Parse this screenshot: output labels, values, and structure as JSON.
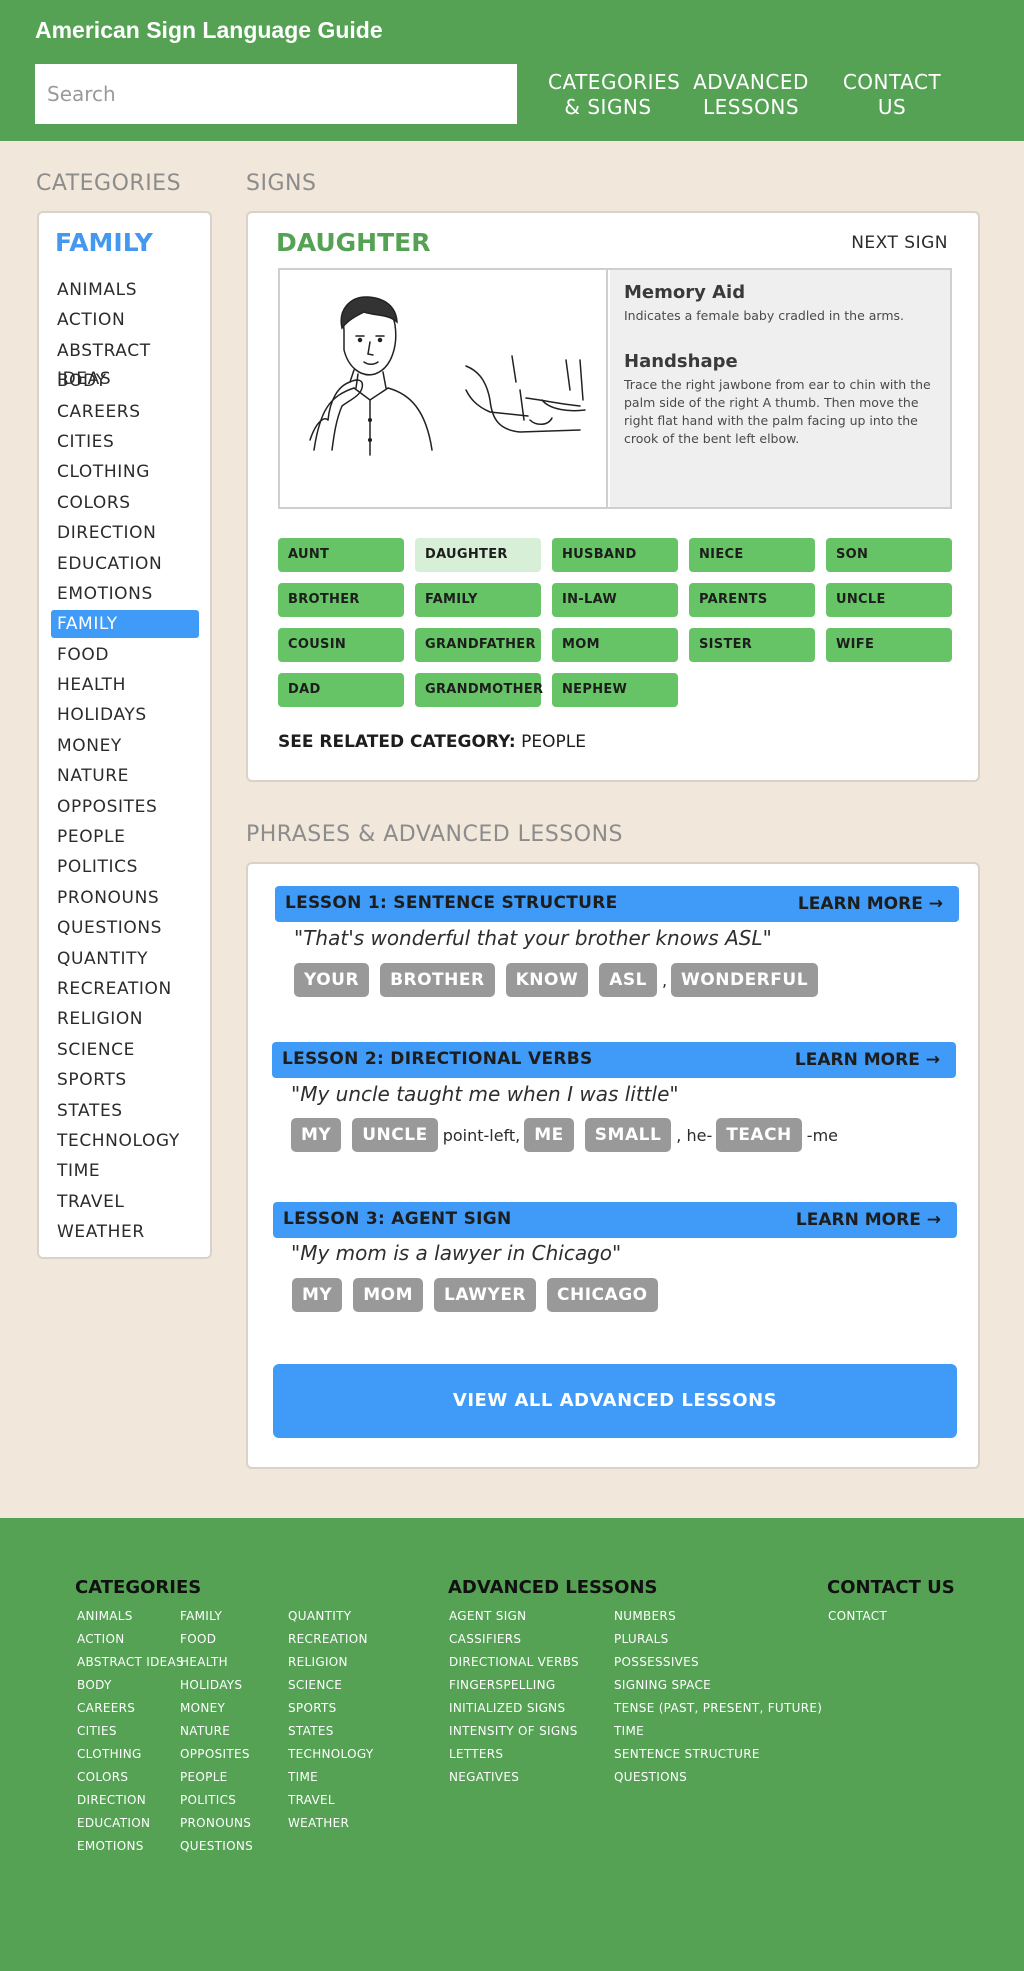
{
  "header": {
    "title": "American Sign Language Guide",
    "search_placeholder": "Search",
    "nav": [
      {
        "line1": "CATEGORIES",
        "line2": "& SIGNS"
      },
      {
        "line1": "ADVANCED",
        "line2": "LESSONS"
      },
      {
        "line1": "CONTACT",
        "line2": "US"
      }
    ]
  },
  "labels": {
    "categories": "CATEGORIES",
    "signs": "SIGNS",
    "phrases": "PHRASES & ADVANCED LESSONS"
  },
  "sidebar": {
    "heading": "FAMILY",
    "items": [
      "ANIMALS",
      "ACTION",
      "ABSTRACT IDEAS",
      "BODY",
      "CAREERS",
      "CITIES",
      "CLOTHING",
      "COLORS",
      "DIRECTION",
      "EDUCATION",
      "EMOTIONS",
      "FAMILY",
      "FOOD",
      "HEALTH",
      "HOLIDAYS",
      "MONEY",
      "NATURE",
      "OPPOSITES",
      "PEOPLE",
      "POLITICS",
      "PRONOUNS",
      "QUESTIONS",
      "QUANTITY",
      "RECREATION",
      "RELIGION",
      "SCIENCE",
      "SPORTS",
      "STATES",
      "TECHNOLOGY",
      "TIME",
      "TRAVEL",
      "WEATHER"
    ],
    "active": "FAMILY"
  },
  "sign": {
    "title": "DAUGHTER",
    "next_label": "NEXT SIGN",
    "memory_aid_heading": "Memory Aid",
    "memory_aid_text": "Indicates a female baby cradled in the arms.",
    "handshape_heading": "Handshape",
    "handshape_text": "Trace the right jawbone from ear to chin with the palm side of the right A thumb. Then move the right flat hand with the palm facing up into the crook of the bent left elbow.",
    "grid": [
      "AUNT",
      "DAUGHTER",
      "HUSBAND",
      "NIECE",
      "SON",
      "BROTHER",
      "FAMILY",
      "IN-LAW",
      "PARENTS",
      "UNCLE",
      "COUSIN",
      "GRANDFATHER",
      "MOM",
      "SISTER",
      "WIFE",
      "DAD",
      "GRANDMOTHER",
      "NEPHEW"
    ],
    "current": "DAUGHTER",
    "related_label": "SEE RELATED CATEGORY:",
    "related_value": "PEOPLE"
  },
  "lessons": [
    {
      "title": "LESSON 1: SENTENCE STRUCTURE",
      "learn_more": "LEARN MORE",
      "phrase": "\"That's wonderful that your brother knows ASL\"",
      "parts": [
        {
          "chip": "YOUR"
        },
        {
          "chip": "BROTHER"
        },
        {
          "chip": "KNOW"
        },
        {
          "chip": "ASL"
        },
        {
          "text": ","
        },
        {
          "chip": "WONDERFUL"
        }
      ]
    },
    {
      "title": "LESSON 2: DIRECTIONAL VERBS",
      "learn_more": "LEARN MORE",
      "phrase": "\"My uncle taught me when I was little\"",
      "parts": [
        {
          "chip": "MY"
        },
        {
          "chip": "UNCLE"
        },
        {
          "text": "point-left,"
        },
        {
          "chip": "ME"
        },
        {
          "chip": "SMALL"
        },
        {
          "text": ", he-"
        },
        {
          "chip": "TEACH"
        },
        {
          "text": "-me"
        }
      ]
    },
    {
      "title": "LESSON 3: AGENT SIGN",
      "learn_more": "LEARN MORE",
      "phrase": "\"My mom is a lawyer in Chicago\"",
      "parts": [
        {
          "chip": "MY"
        },
        {
          "chip": "MOM"
        },
        {
          "chip": "LAWYER"
        },
        {
          "chip": "CHICAGO"
        }
      ]
    }
  ],
  "view_all": "VIEW ALL ADVANCED LESSONS",
  "footer": {
    "categories_heading": "CATEGORIES",
    "categories_cols": [
      [
        "ANIMALS",
        "ACTION",
        "ABSTRACT IDEAS",
        "BODY",
        "CAREERS",
        "CITIES",
        "CLOTHING",
        "COLORS",
        "DIRECTION",
        "EDUCATION",
        "EMOTIONS"
      ],
      [
        "FAMILY",
        "FOOD",
        "HEALTH",
        "HOLIDAYS",
        "MONEY",
        "NATURE",
        "OPPOSITES",
        "PEOPLE",
        "POLITICS",
        "PRONOUNS",
        "QUESTIONS"
      ],
      [
        "QUANTITY",
        "RECREATION",
        "RELIGION",
        "SCIENCE",
        "SPORTS",
        "STATES",
        "TECHNOLOGY",
        "TIME",
        "TRAVEL",
        "WEATHER"
      ]
    ],
    "lessons_heading": "ADVANCED LESSONS",
    "lessons_cols": [
      [
        "AGENT SIGN",
        "CASSIFIERS",
        "DIRECTIONAL VERBS",
        "FINGERSPELLING",
        "INITIALIZED SIGNS",
        "INTENSITY OF SIGNS",
        "LETTERS",
        "NEGATIVES"
      ],
      [
        "NUMBERS",
        "PLURALS",
        "POSSESSIVES",
        "SIGNING SPACE",
        "TENSE (PAST, PRESENT, FUTURE)",
        "TIME",
        "SENTENCE STRUCTURE",
        "QUESTIONS"
      ]
    ],
    "contact_heading": "CONTACT US",
    "contact_links": [
      "CONTACT"
    ]
  }
}
